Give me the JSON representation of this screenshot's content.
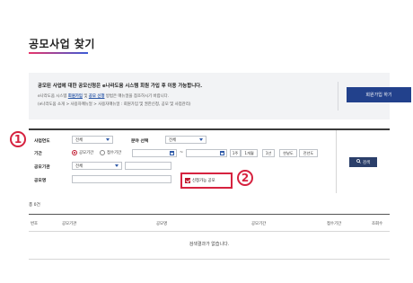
{
  "page": {
    "title": "공모사업 찾기"
  },
  "notice": {
    "line1": "공모된 사업에 대한 공모신청은 e나라도움 시스템 회원 가입 후 이용 가능합니다.",
    "line2_prefix": "e나라도움 시스템 ",
    "line2_link1": "회원가입",
    "line2_mid": " 및 ",
    "line2_link2": "공모 신청",
    "line2_suffix": " 방법은 매뉴얼을 참조하시기 바랍니다.",
    "line3": "(e나라도움 소개 > 사용자매뉴얼 > 사용자매뉴얼 : 회원가입 및 권한신청, 공모 및 사업관리)",
    "join_button": "회원가입 하기"
  },
  "search": {
    "year_label": "사업연도",
    "year_value": "전체",
    "field_label": "분야 선택",
    "field_value": "전체",
    "period_label": "기간",
    "radio_notice_period": "공모기간",
    "radio_receipt_period": "접수기간",
    "period_buttons": [
      "1주",
      "1개월",
      "1년",
      "한낱도",
      "전년도"
    ],
    "agency_label": "공모기관",
    "agency_value": "전체",
    "name_label": "공모명",
    "checkbox_label": "신청가능 공모",
    "search_button": "검색"
  },
  "annotations": {
    "marker1": "1",
    "marker2": "2"
  },
  "results": {
    "total_text": "총 0건",
    "columns": [
      "번호",
      "공모기관",
      "공모명",
      "공모기간",
      "접수기간",
      "조회수"
    ],
    "empty_message": "검색결과가 없습니다."
  },
  "colors": {
    "accent_red": "#d6223f",
    "primary_navy": "#22418c"
  }
}
